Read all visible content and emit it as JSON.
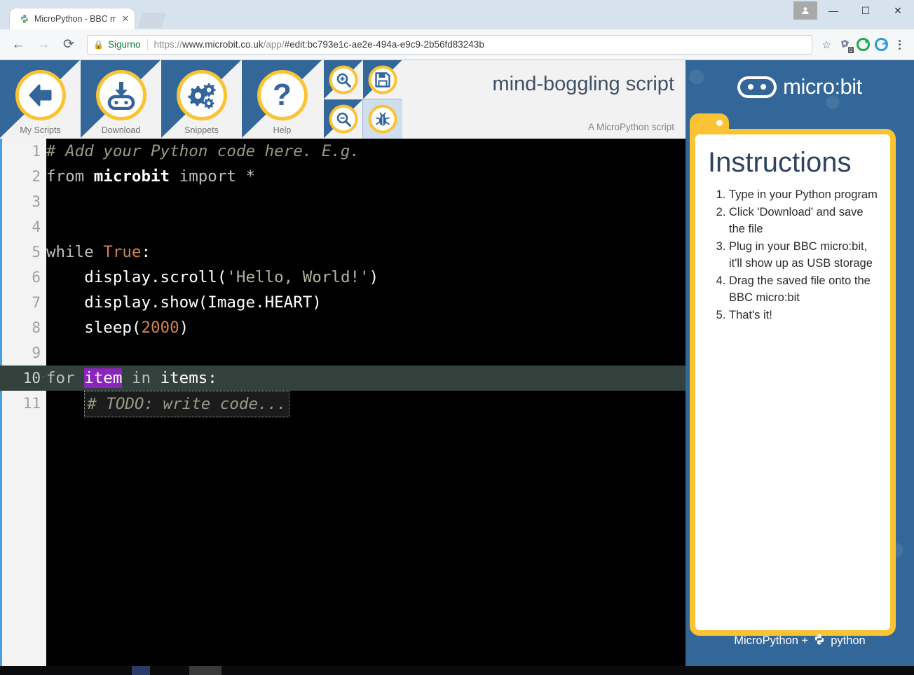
{
  "browser": {
    "tab": {
      "title": "MicroPython - BBC micro",
      "favicon_icon": "python-favicon",
      "close_icon": "close-icon"
    },
    "newtab_icon": "new-tab-icon",
    "window_controls": {
      "minimize": "—",
      "maximize": "☐",
      "close": "✕",
      "profile_icon": "profile-icon"
    },
    "nav": {
      "back_icon": "←",
      "forward_icon": "→",
      "reload_icon": "⟳",
      "lock_icon": "lock-icon",
      "secure_label": "Sigurno",
      "url_scheme": "https://",
      "url_host": "www.microbit.co.uk",
      "url_path": "/app/",
      "url_fragment": "#edit:bc793e1c-ae2e-494a-e9c9-2b56fd83243b",
      "star_icon": "☆",
      "extension_badge": "0",
      "menu_icon": "kebab-menu-icon"
    }
  },
  "toolbar": {
    "buttons": [
      {
        "label": "My Scripts",
        "icon": "back-arrow-icon"
      },
      {
        "label": "Download",
        "icon": "download-microbit-icon"
      },
      {
        "label": "Snippets",
        "icon": "gears-icon"
      },
      {
        "label": "Help",
        "icon": "question-mark-icon"
      }
    ],
    "mini_buttons": [
      {
        "name": "zoom-in",
        "icon": "magnifier-plus-icon",
        "active": false
      },
      {
        "name": "save",
        "icon": "floppy-disk-icon",
        "active": false
      },
      {
        "name": "zoom-out",
        "icon": "magnifier-minus-icon",
        "active": false
      },
      {
        "name": "debug",
        "icon": "bug-icon",
        "active": true
      }
    ],
    "script_title": "mind-boggling script",
    "script_subtitle": "A MicroPython script"
  },
  "editor": {
    "line_numbers": [
      "1",
      "2",
      "3",
      "4",
      "5",
      "6",
      "7",
      "8",
      "9",
      "10",
      "11"
    ],
    "active_line": 10,
    "fold_marker": "·",
    "selected_token": "item",
    "lines": [
      {
        "n": 1,
        "text": "# Add your Python code here. E.g."
      },
      {
        "n": 2,
        "text": "from microbit import *"
      },
      {
        "n": 3,
        "text": ""
      },
      {
        "n": 4,
        "text": ""
      },
      {
        "n": 5,
        "text": "while True:"
      },
      {
        "n": 6,
        "text": "    display.scroll('Hello, World!')"
      },
      {
        "n": 7,
        "text": "    display.show(Image.HEART)"
      },
      {
        "n": 8,
        "text": "    sleep(2000)"
      },
      {
        "n": 9,
        "text": ""
      },
      {
        "n": 10,
        "text": "for item in items:"
      },
      {
        "n": 11,
        "text": "    # TODO: write code..."
      }
    ],
    "fragments": {
      "l1_comment": "# Add your Python code here. E.g.",
      "l2_from": "from ",
      "l2_module": "microbit",
      "l2_import": " import ",
      "l2_star": "*",
      "l5_while": "while ",
      "l5_true": "True",
      "l5_colon": ":",
      "l6_indent": "    ",
      "l6_call": "display.scroll(",
      "l6_str": "'Hello, World!'",
      "l6_end": ")",
      "l7_indent": "    ",
      "l7_call": "display.show(Image.HEART)",
      "l8_indent": "    ",
      "l8_sleep": "sleep(",
      "l8_num": "2000",
      "l8_end": ")",
      "l10_for": "for ",
      "l10_item": "item",
      "l10_in": " in ",
      "l10_items": "items:",
      "l11_indent": "    ",
      "l11_todo": "# TODO: write code..."
    },
    "colors": {
      "background": "#000000",
      "gutter_background": "#f3f3f3",
      "active_line": "#33413c",
      "selection": "#8b23bd",
      "comment": "#9a9a88",
      "constant": "#d2834a"
    }
  },
  "right_panel": {
    "logo_text": "micro:bit",
    "logo_icon": "microbit-face-icon",
    "instructions_title": "Instructions",
    "instructions": [
      "Type in your Python program",
      "Click 'Download' and save the file",
      "Plug in your BBC micro:bit, it'll show up as USB storage",
      "Drag the saved file onto the BBC micro:bit",
      "That's it!"
    ],
    "footer_prefix": "MicroPython +",
    "footer_icon": "python-logo-icon",
    "footer_suffix": "python",
    "colors": {
      "blue": "#336699",
      "yellow": "#f9c333",
      "card": "#ffffff"
    }
  }
}
